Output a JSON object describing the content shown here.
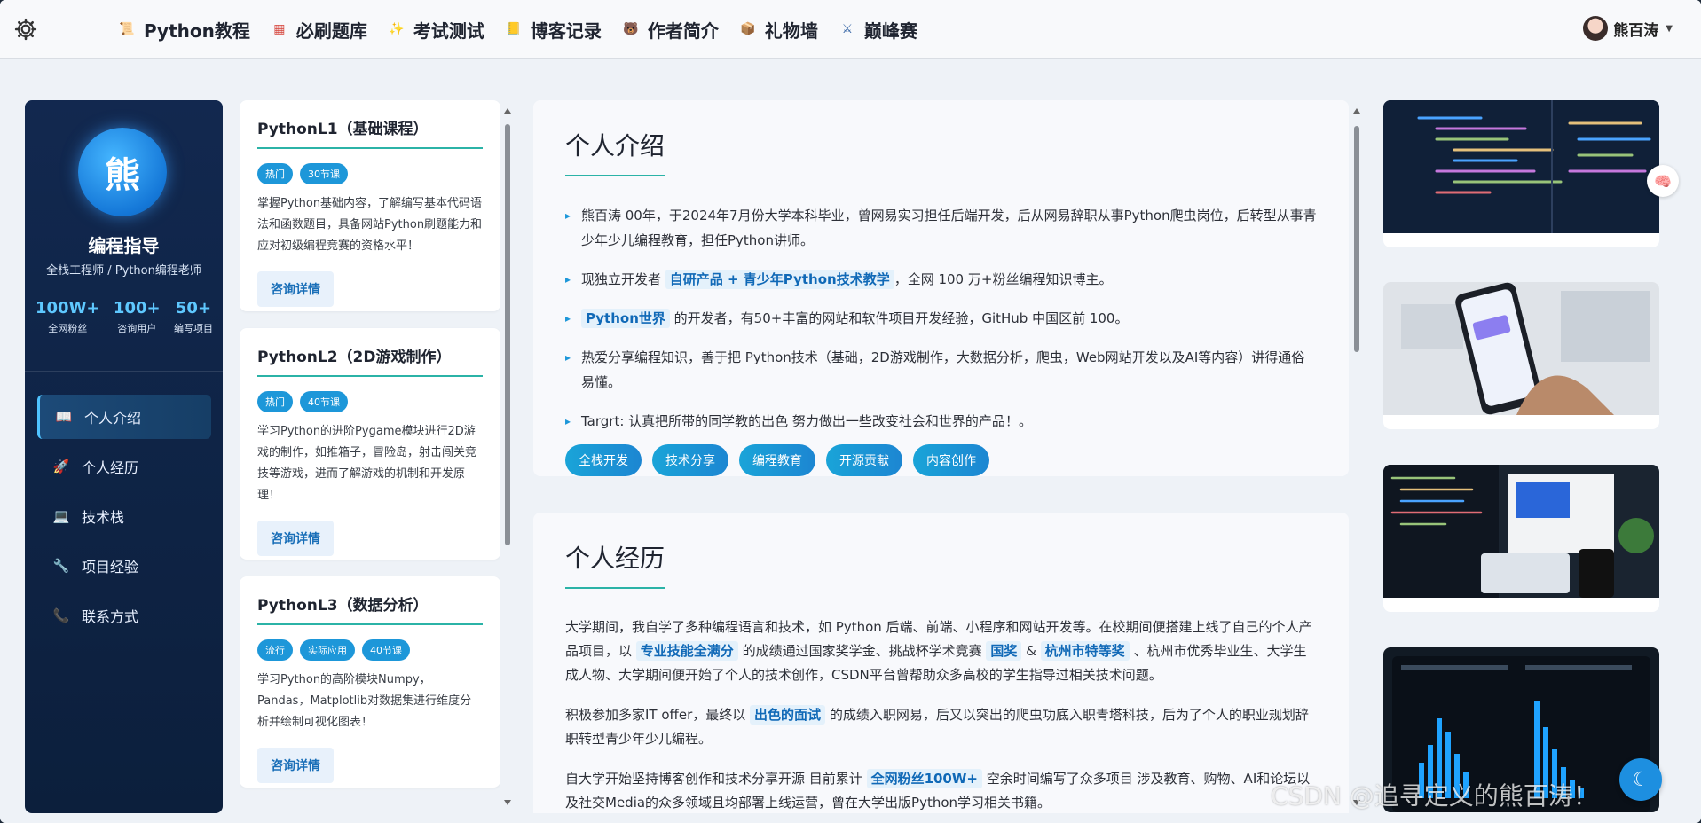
{
  "nav": {
    "items": [
      {
        "label": "Python教程",
        "icon": "scroll-icon",
        "glyph": "📜",
        "color": "#e8a93a"
      },
      {
        "label": "必刷题库",
        "icon": "grid-icon",
        "glyph": "▦",
        "color": "#d6463d"
      },
      {
        "label": "考试测试",
        "icon": "sparkle-icon",
        "glyph": "✨",
        "color": "#f1b73a"
      },
      {
        "label": "博客记录",
        "icon": "notebook-icon",
        "glyph": "📒",
        "color": "#e2a72b"
      },
      {
        "label": "作者简介",
        "icon": "bear-icon",
        "glyph": "🐻",
        "color": "#b06a3a"
      },
      {
        "label": "礼物墙",
        "icon": "gift-box-icon",
        "glyph": "📦",
        "color": "#c48a55"
      },
      {
        "label": "巅峰赛",
        "icon": "crossed-swords-icon",
        "glyph": "⚔",
        "color": "#3c6aa8"
      }
    ]
  },
  "user": {
    "name": "熊百涛"
  },
  "profile": {
    "avatar_char": "熊",
    "name": "编程指导",
    "subtitle": "全栈工程师 / Python编程老师",
    "stats": [
      {
        "num": "100W+",
        "cap": "全网粉丝"
      },
      {
        "num": "100+",
        "cap": "咨询用户"
      },
      {
        "num": "50+",
        "cap": "编写项目"
      }
    ]
  },
  "menu": [
    {
      "label": "个人介绍",
      "icon": "book-icon",
      "glyph": "📖",
      "active": true
    },
    {
      "label": "个人经历",
      "icon": "rocket-icon",
      "glyph": "🚀",
      "active": false
    },
    {
      "label": "技术栈",
      "icon": "laptop-icon",
      "glyph": "💻",
      "active": false
    },
    {
      "label": "项目经验",
      "icon": "wrench-icon",
      "glyph": "🔧",
      "active": false
    },
    {
      "label": "联系方式",
      "icon": "phone-icon",
      "glyph": "📞",
      "active": false
    }
  ],
  "courses": [
    {
      "title": "PythonL1（基础课程）",
      "tags": [
        "热门",
        "30节课"
      ],
      "desc": "掌握Python基础内容，了解编写基本代码语法和函数题目，具备网站Python刷题能力和应对初级编程竞赛的资格水平！",
      "button": "咨询详情"
    },
    {
      "title": "PythonL2（2D游戏制作）",
      "tags": [
        "热门",
        "40节课"
      ],
      "desc": "学习Python的进阶Pygame模块进行2D游戏的制作，如推箱子，冒险岛，射击闯关竞技等游戏，进而了解游戏的机制和开发原理！",
      "button": "咨询详情"
    },
    {
      "title": "PythonL3（数据分析）",
      "tags": [
        "流行",
        "实际应用",
        "40节课"
      ],
      "desc": "学习Python的高阶模块Numpy，Pandas，Matplotlib对数据集进行维度分析并绘制可视化图表！",
      "button": "咨询详情"
    }
  ],
  "intro": {
    "title": "个人介绍",
    "b1": "熊百涛 00年，于2024年7月份大学本科毕业，曾网易实习担任后端开发，后从网易辞职从事Python爬虫岗位，后转型从事青少年少儿编程教育，担任Python讲师。",
    "b2_pre": "现独立开发者",
    "b2_hl": "自研产品 + 青少年Python技术教学",
    "b2_post": "，全网 100 万+粉丝编程知识博主。",
    "b3_hl": "Python世界",
    "b3_post": "的开发者，有50+丰富的网站和软件项目开发经验，GitHub 中国区前 100。",
    "b4": "热爱分享编程知识，善于把 Python技术（基础，2D游戏制作，大数据分析，爬虫，Web网站开发以及AI等内容）讲得通俗易懂。",
    "b5": "Targrt: 认真把所带的同学教的出色 努力做出一些改变社会和世界的产品！。",
    "pills": [
      "全栈开发",
      "技术分享",
      "编程教育",
      "开源贡献",
      "内容创作"
    ]
  },
  "experience": {
    "title": "个人经历",
    "p1_a": "大学期间，我自学了多种编程语言和技术，如 Python 后端、前端、小程序和网站开发等。在校期间便搭建上线了自己的个人产品项目，以",
    "p1_hl1": "专业技能全满分",
    "p1_b": "的成绩通过国家奖学金、挑战杯学术竞赛",
    "p1_hl2": "国奖",
    "p1_c": "&",
    "p1_hl3": "杭州市特等奖",
    "p1_d": "、杭州市优秀毕业生、大学生成人物、大学期间便开始了个人的技术创作，CSDN平台曾帮助众多高校的学生指导过相关技术问题。",
    "p2_a": "积极参加多家IT offer，最终以",
    "p2_hl": "出色的面试",
    "p2_b": "的成绩入职网易，后又以突出的爬虫功底入职青塔科技，后为了个人的职业规划辞职转型青少年少儿编程。",
    "p3_a": "自大学开始坚持博客创作和技术分享开源 目前累计",
    "p3_hl": "全网粉丝100W+",
    "p3_b": "空余时间编写了众多项目 涉及教育、购物、AI和论坛以及社交Media的众多领域且均部署上线运营，曾在大学出版Python学习相关书籍。"
  },
  "watermark": "CSDN @追寻定义的熊百涛！"
}
